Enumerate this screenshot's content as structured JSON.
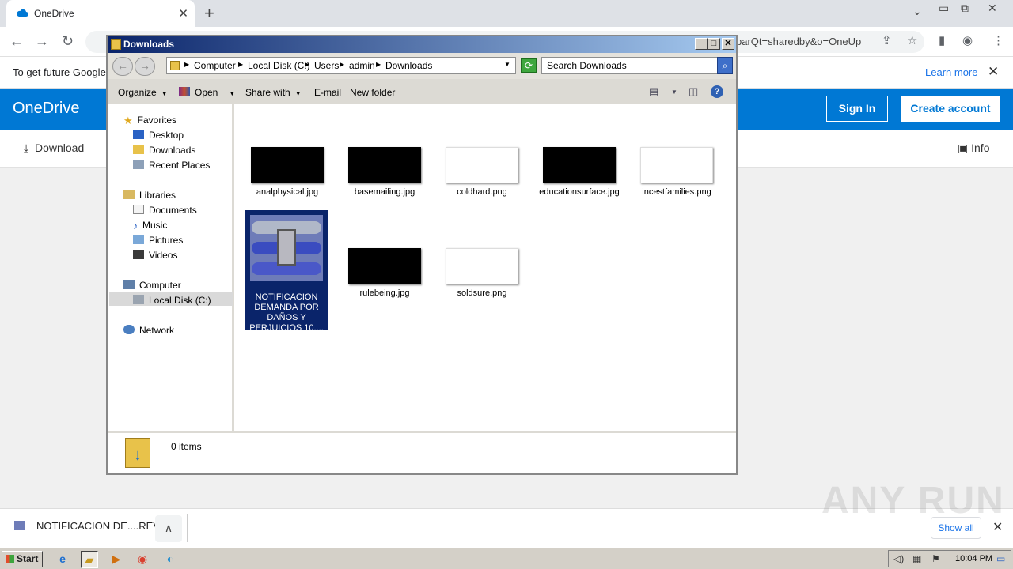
{
  "browser": {
    "tab_title": "OneDrive",
    "url_fragment": "parQt=sharedby&o=OneUp",
    "infobar_message": "To get future Google",
    "infobar_link": "Learn more"
  },
  "onedrive": {
    "brand": "OneDrive",
    "sign_in": "Sign In",
    "create_account": "Create account",
    "download": "Download",
    "info": "Info"
  },
  "download_shelf": {
    "item": "NOTIFICACION DE....REV",
    "show_all": "Show all"
  },
  "watermark": "ANY RUN",
  "explorer": {
    "title": "Downloads",
    "breadcrumb": [
      "Computer",
      "Local Disk (C:)",
      "Users",
      "admin",
      "Downloads"
    ],
    "search_placeholder": "Search Downloads",
    "commands": {
      "organize": "Organize",
      "open": "Open",
      "share_with": "Share with",
      "email": "E-mail",
      "new_folder": "New folder"
    },
    "nav": {
      "favorites": "Favorites",
      "desktop": "Desktop",
      "downloads": "Downloads",
      "recent_places": "Recent Places",
      "libraries": "Libraries",
      "documents": "Documents",
      "music": "Music",
      "pictures": "Pictures",
      "videos": "Videos",
      "computer": "Computer",
      "local_disk": "Local Disk (C:)",
      "network": "Network"
    },
    "files": [
      {
        "name": "analphysical.jpg",
        "thumb": "black"
      },
      {
        "name": "basemailing.jpg",
        "thumb": "black"
      },
      {
        "name": "coldhard.png",
        "thumb": "white"
      },
      {
        "name": "educationsurface.jpg",
        "thumb": "black"
      },
      {
        "name": "incestfamilies.png",
        "thumb": "white"
      },
      {
        "name": "NOTIFICACION DEMANDA POR DAÑOS Y PERJUICIOS 10....",
        "thumb": "archive",
        "selected": true
      },
      {
        "name": "rulebeing.jpg",
        "thumb": "black"
      },
      {
        "name": "soldsure.png",
        "thumb": "white"
      }
    ],
    "status": "0 items"
  },
  "taskbar": {
    "start": "Start",
    "clock": "10:04 PM"
  },
  "colors": {
    "onedrive_blue": "#0078d4",
    "selection": "#0a246a"
  }
}
